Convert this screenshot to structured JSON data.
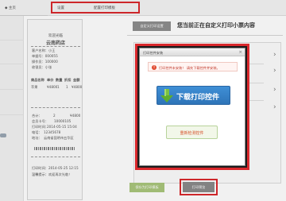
{
  "nav": {
    "home": "◆ 主页",
    "settings": "设置",
    "print_template": "配置打印模板"
  },
  "receipt": {
    "shop_header": "欢迎光临",
    "shop_name": "云南药店",
    "fields": [
      "客户名称：小王",
      "单据号：000055",
      "操作员：100000",
      "收银员：小张"
    ],
    "table_header": [
      "商品名称",
      "单价",
      "数量",
      "折扣",
      "金额"
    ],
    "table_row": [
      "苹果",
      "¥4800",
      "1",
      "1",
      "¥4800"
    ],
    "totals": [
      [
        "合计：",
        "2",
        "¥4800"
      ],
      [
        "会员卡号：",
        "10000105"
      ],
      [
        "打印时间：",
        "2014-05-15 15:04"
      ],
      [
        "电话：",
        "12345678"
      ],
      [
        "地址：",
        "云南省昆明市五华区"
      ]
    ],
    "footer": [
      "打印时间：2014-05-25 12:15",
      "温馨提示：欢迎再次光临！"
    ]
  },
  "header": {
    "tab_label": "自定义打印设置",
    "title": "您当前正在自定义打印小票内容"
  },
  "dialog": {
    "title": "打印控件安装",
    "close": "×",
    "alert_icon": "!",
    "alert": "打印控件未安装！ 请先下载控件并安装。",
    "download_label": "下载打印控件",
    "recheck_label": "重新检测控件"
  },
  "footer": {
    "save_label": "保存为打印模板",
    "print_label": "打印预览"
  },
  "colors": {
    "highlight": "#d9282c",
    "download": "#3278c2",
    "save": "#a9c67c",
    "recheck_text": "#d64d26"
  },
  "icons": [
    "download-arrow-icon",
    "warning-icon",
    "chevron-right-icon",
    "close-icon"
  ]
}
